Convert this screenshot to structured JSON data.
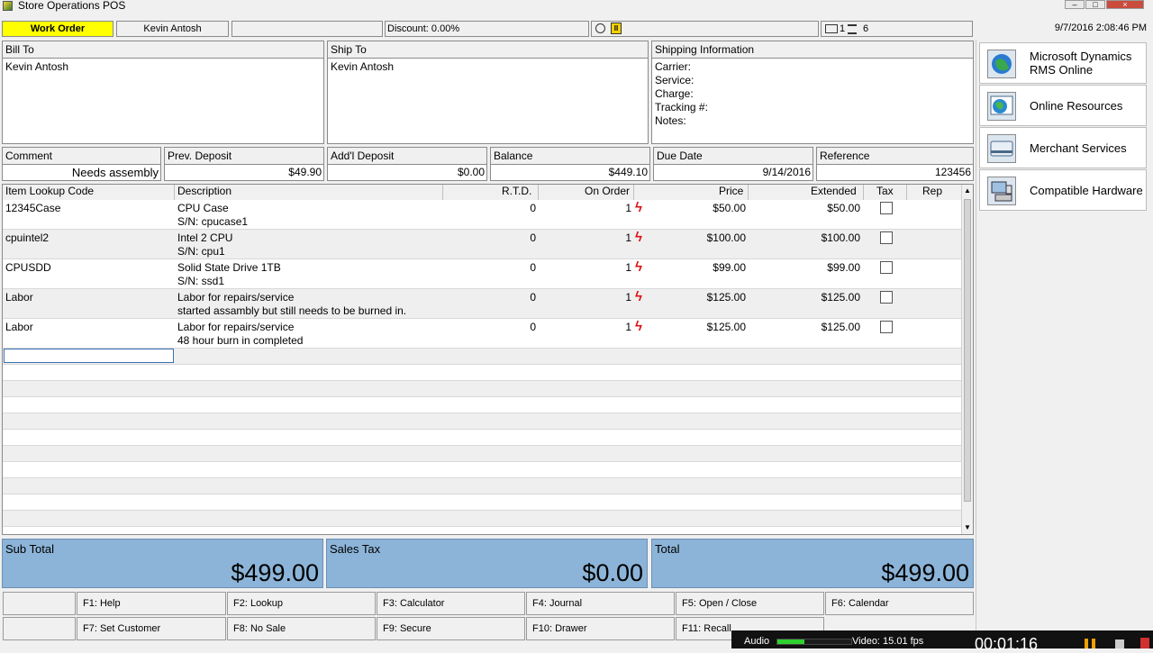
{
  "window": {
    "title": "Store Operations POS"
  },
  "status_bar": {
    "mode": "Work Order",
    "customer": "Kevin Antosh",
    "discount": "Discount: 0.00%",
    "station": "1",
    "count": "6",
    "datetime": "9/7/2016 2:08:46 PM"
  },
  "bill_to": {
    "label": "Bill To",
    "name": "Kevin Antosh"
  },
  "ship_to": {
    "label": "Ship To",
    "name": "Kevin Antosh"
  },
  "shipping": {
    "label": "Shipping Information",
    "fields": [
      "Carrier:",
      "Service:",
      "Charge:",
      "Tracking #:",
      "Notes:"
    ]
  },
  "info_fields": [
    {
      "label": "Comment",
      "value": "Needs assembly"
    },
    {
      "label": "Prev. Deposit",
      "value": "$49.90"
    },
    {
      "label": "Add'l Deposit",
      "value": "$0.00"
    },
    {
      "label": "Balance",
      "value": "$449.10"
    },
    {
      "label": "Due Date",
      "value": "9/14/2016"
    },
    {
      "label": "Reference",
      "value": "123456"
    }
  ],
  "grid": {
    "columns": [
      "Item Lookup Code",
      "Description",
      "R.T.D.",
      "On Order",
      "Price",
      "Extended",
      "Tax",
      "Rep"
    ],
    "rows": [
      {
        "code": "12345Case",
        "desc": "CPU Case",
        "sub": "S/N: cpucase1",
        "rtd": "0",
        "on_order": "1",
        "price": "$50.00",
        "extended": "$50.00"
      },
      {
        "code": "cpuintel2",
        "desc": "Intel 2 CPU",
        "sub": "S/N: cpu1",
        "rtd": "0",
        "on_order": "1",
        "price": "$100.00",
        "extended": "$100.00"
      },
      {
        "code": "CPUSDD",
        "desc": "Solid State Drive 1TB",
        "sub": "S/N: ssd1",
        "rtd": "0",
        "on_order": "1",
        "price": "$99.00",
        "extended": "$99.00"
      },
      {
        "code": "Labor",
        "desc": "Labor for repairs/service",
        "sub": "started assambly but still needs to be burned in.",
        "rtd": "0",
        "on_order": "1",
        "price": "$125.00",
        "extended": "$125.00"
      },
      {
        "code": "Labor",
        "desc": "Labor for repairs/service",
        "sub": "48 hour burn in completed",
        "rtd": "0",
        "on_order": "1",
        "price": "$125.00",
        "extended": "$125.00"
      }
    ]
  },
  "totals": [
    {
      "label": "Sub Total",
      "value": "$499.00"
    },
    {
      "label": "Sales Tax",
      "value": "$0.00"
    },
    {
      "label": "Total",
      "value": "$499.00"
    }
  ],
  "function_keys": {
    "row1": [
      "F1: Help",
      "F2: Lookup",
      "F3: Calculator",
      "F4: Journal",
      "F5: Open / Close",
      "F6: Calendar"
    ],
    "row2": [
      "F7: Set Customer",
      "F8: No Sale",
      "F9: Secure",
      "F10: Drawer",
      "F11: Recall"
    ]
  },
  "side_links": [
    {
      "label": "Microsoft Dynamics RMS Online",
      "icon": "globe-icon"
    },
    {
      "label": "Online Resources",
      "icon": "web-resources-icon"
    },
    {
      "label": "Merchant Services",
      "icon": "credit-card-icon"
    },
    {
      "label": "Compatible Hardware",
      "icon": "hardware-icon"
    }
  ],
  "recorder": {
    "audio": "Audio",
    "video": "Video: 15.01 fps",
    "time": "00:01:16"
  },
  "colors": {
    "mode_highlight": "#ffff00",
    "totals_bg": "#8cb4d8",
    "bolt": "#e01010"
  }
}
